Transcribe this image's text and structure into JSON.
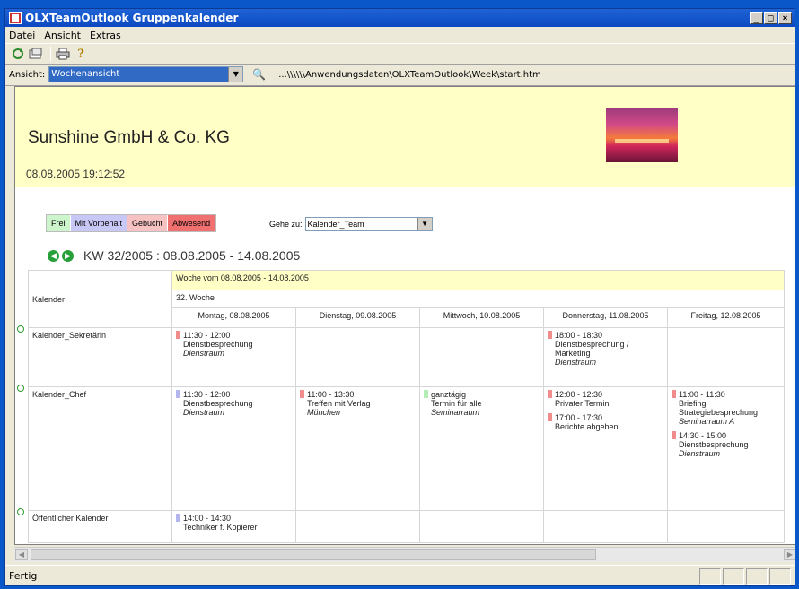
{
  "window": {
    "title": "OLXTeamOutlook Gruppenkalender",
    "controls": [
      "_",
      "□",
      "×"
    ]
  },
  "menu": [
    "Datei",
    "Ansicht",
    "Extras"
  ],
  "toolbar": {
    "icons": [
      "refresh-icon",
      "open-icon",
      "print-icon",
      "help-icon"
    ]
  },
  "addressbar": {
    "label": "Ansicht:",
    "view_value": "Wochenansicht",
    "path": "...\\\\\\\\\\\\Anwendungsdaten\\OLXTeamOutlook\\Week\\start.htm"
  },
  "header": {
    "company": "Sunshine GmbH & Co. KG",
    "datetime": "08.08.2005 19:12:52"
  },
  "legend": [
    {
      "label": "Frei",
      "color": "#ccf5cc"
    },
    {
      "label": "Mit Vorbehalt",
      "color": "#c8c8f6"
    },
    {
      "label": "Gebucht",
      "color": "#f6c2c2"
    },
    {
      "label": "Abwesend",
      "color": "#f07070"
    }
  ],
  "goto": {
    "label": "Gehe zu:",
    "value": "Kalender_Team"
  },
  "week": {
    "label": "KW 32/2005 :  08.08.2005 - 14.08.2005"
  },
  "calendar": {
    "col_header": "Kalender",
    "week_range": "Woche vom 08.08.2005 - 14.08.2005",
    "week_no": "32. Woche",
    "days": [
      "Montag, 08.08.2005",
      "Dienstag, 09.08.2005",
      "Mittwoch, 10.08.2005",
      "Donnerstag, 11.08.2005",
      "Freitag, 12.08.2005"
    ],
    "rows": [
      {
        "name": "Kalender_Sekretärin",
        "cells": [
          [
            {
              "time": "11:30 - 12:00",
              "title": "Dienstbesprechung",
              "place": "Dienstraum",
              "color": "red"
            }
          ],
          [],
          [],
          [
            {
              "time": "18:00 - 18:30",
              "title": "Dienstbesprechung / Marketing",
              "place": "Dienstraum",
              "color": "red"
            }
          ],
          []
        ]
      },
      {
        "name": "Kalender_Chef",
        "cells": [
          [
            {
              "time": "11:30 - 12:00",
              "title": "Dienstbesprechung",
              "place": "Dienstraum",
              "color": "blue"
            }
          ],
          [
            {
              "time": "11:00 - 13:30",
              "title": "Treffen mit Verlag",
              "place": "München",
              "color": "red"
            }
          ],
          [
            {
              "time": "ganztägig",
              "title": "Termin für alle",
              "place": "Seminarraum",
              "color": "green"
            }
          ],
          [
            {
              "time": "12:00 - 12:30",
              "title": "Privater Termin",
              "place": "",
              "color": "red"
            },
            {
              "time": "17:00 - 17:30",
              "title": "Berichte abgeben",
              "place": "",
              "color": "red"
            }
          ],
          [
            {
              "time": "11:00 - 11:30",
              "title": "Briefing Strategiebesprechung",
              "place": "Seminarraum A",
              "color": "red"
            },
            {
              "time": "14:30 - 15:00",
              "title": "Dienstbesprechung",
              "place": "Dienstraum",
              "color": "red"
            }
          ]
        ]
      },
      {
        "name": "Öffentlicher Kalender",
        "cells": [
          [
            {
              "time": "14:00 - 14:30",
              "title": "Techniker f. Kopierer",
              "place": "",
              "color": "blue"
            }
          ],
          [],
          [],
          [],
          []
        ]
      }
    ]
  },
  "status": {
    "text": "Fertig"
  }
}
